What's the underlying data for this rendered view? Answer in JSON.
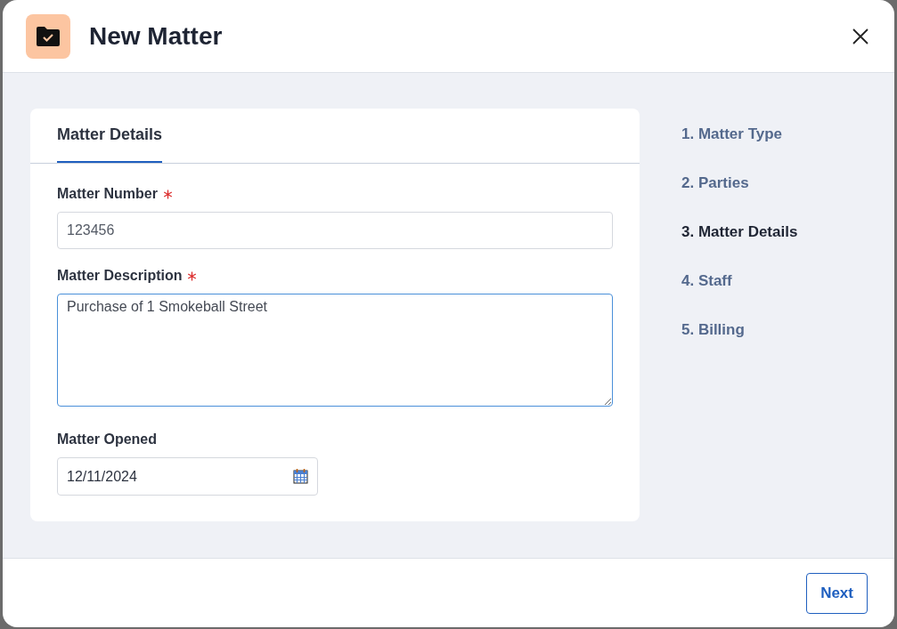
{
  "dialog": {
    "title": "New Matter"
  },
  "tabs": [
    {
      "label": "Matter Details",
      "selected": true
    }
  ],
  "fields": [
    {
      "kind": "text",
      "label": "Matter Number",
      "required": true,
      "value": "123456",
      "focused": false
    },
    {
      "kind": "textarea",
      "label": "Matter Description",
      "required": true,
      "value": "Purchase of 1 Smokeball Street",
      "focused": true
    },
    {
      "kind": "date",
      "label": "Matter Opened",
      "required": false,
      "value": "12/11/2024",
      "focused": false
    }
  ],
  "steps": [
    {
      "label": "1. Matter Type",
      "selected": false
    },
    {
      "label": "2. Parties",
      "selected": false
    },
    {
      "label": "3. Matter Details",
      "selected": true
    },
    {
      "label": "4. Staff",
      "selected": false
    },
    {
      "label": "5. Billing",
      "selected": false
    }
  ],
  "buttons": [
    "Next"
  ]
}
